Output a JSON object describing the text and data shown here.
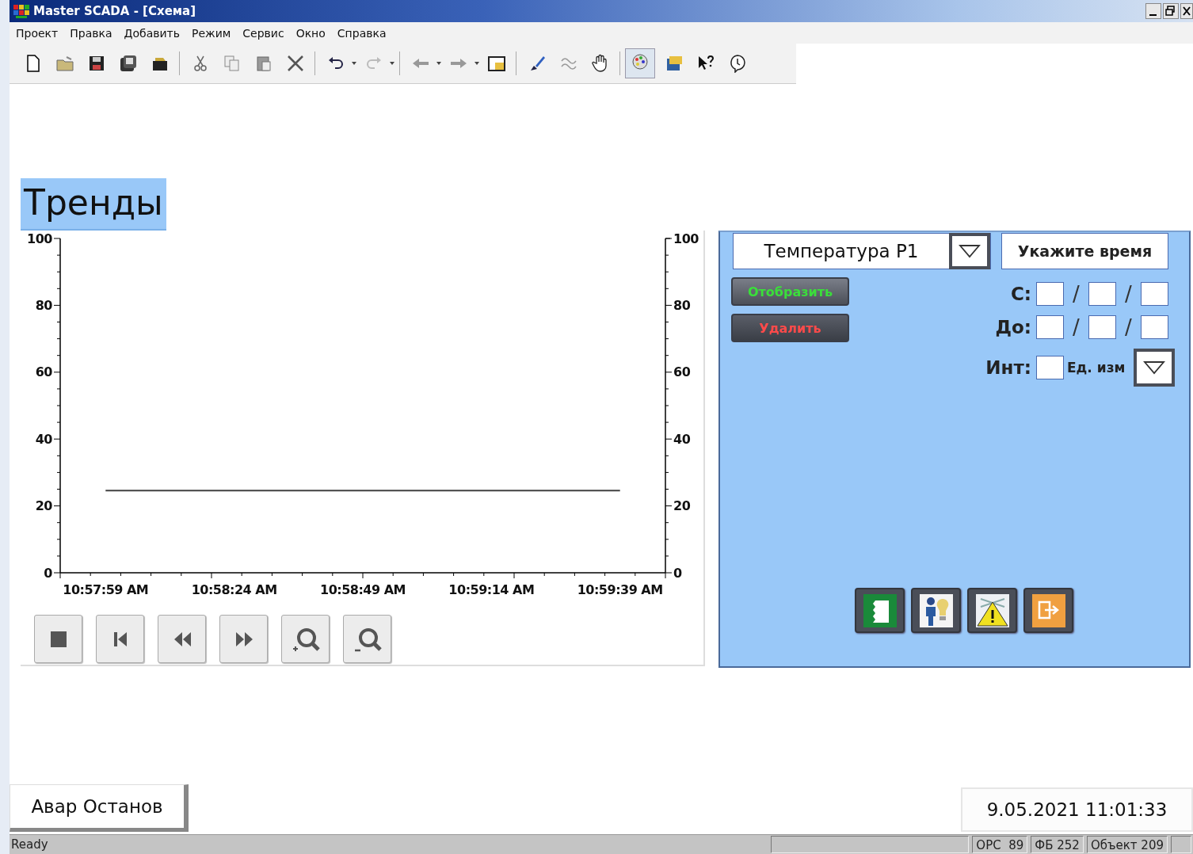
{
  "window": {
    "title": "Master SCADA - [Схема]"
  },
  "menu": [
    "Проект",
    "Правка",
    "Добавить",
    "Режим",
    "Сервис",
    "Окно",
    "Справка"
  ],
  "heading": "Тренды",
  "chart": {
    "chart_data": {
      "type": "line",
      "categories": [
        "10:57:59 AM",
        "10:58:24 AM",
        "10:58:49 AM",
        "10:59:14 AM",
        "10:59:39 AM"
      ],
      "series": [
        {
          "color": "#404040",
          "values": [
            24.6,
            24.6,
            24.6,
            24.6,
            24.6
          ]
        }
      ],
      "ylim": [
        0,
        100
      ],
      "yticks": [
        0,
        20,
        40,
        60,
        80,
        100
      ]
    },
    "right_axis_ticks": [
      "100",
      "80",
      "60",
      "40",
      "20",
      "0"
    ]
  },
  "panel": {
    "parameter": {
      "value": "Температура P1"
    },
    "time_button": "Укажите время",
    "show_button": "Отобразить",
    "delete_button": "Удалить",
    "from": {
      "label": "С:",
      "separators": [
        "/",
        "/"
      ]
    },
    "to": {
      "label": "До:",
      "separators": [
        "/",
        "/"
      ]
    },
    "interval": {
      "label": "Инт:",
      "unit_label": "Ед. изм"
    }
  },
  "alarm_button": "Авар Останов",
  "datetime": "9.05.2021 11:01:33",
  "status_bar": {
    "message": "Ready",
    "panes": [
      "OPC  89",
      "ФБ 252",
      "Объект 209"
    ]
  }
}
